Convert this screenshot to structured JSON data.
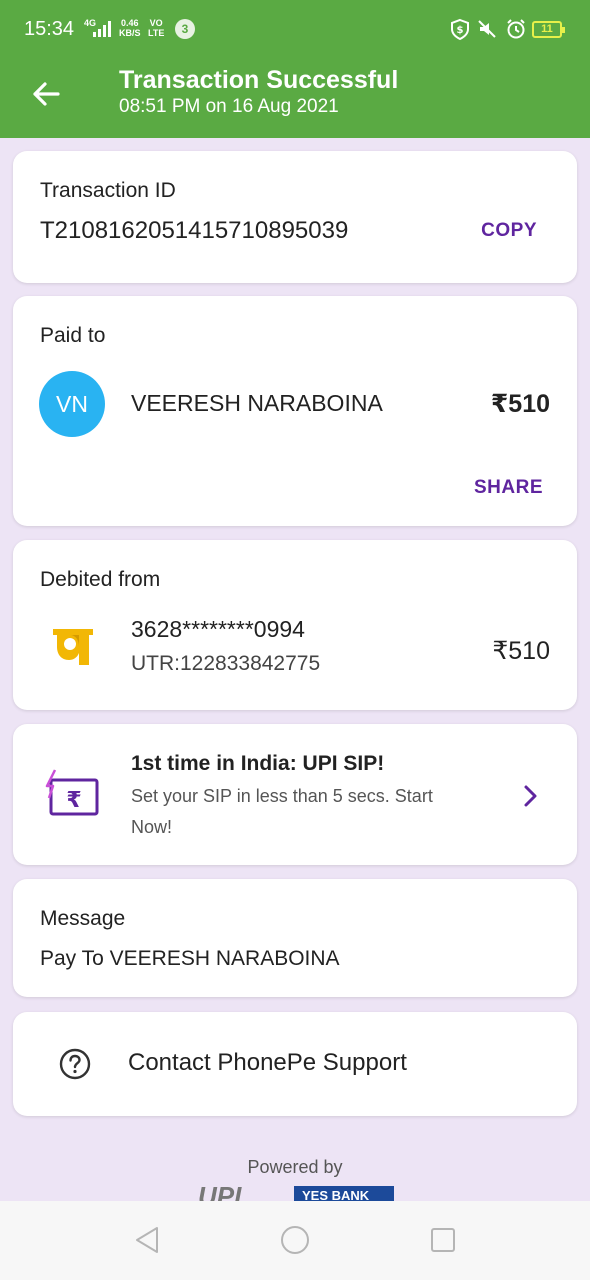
{
  "status_bar": {
    "time": "15:34",
    "network_top": "4G",
    "speed_value": "0.46",
    "speed_unit": "KB/S",
    "volte_top": "VO",
    "volte_bottom": "LTE",
    "notification_count": "3",
    "battery": "11"
  },
  "header": {
    "title": "Transaction Successful",
    "subtitle": "08:51 PM on 16 Aug 2021"
  },
  "transaction": {
    "label": "Transaction ID",
    "id": "T2108162051415710895039",
    "copy_label": "COPY"
  },
  "paid_to": {
    "label": "Paid to",
    "initials": "VN",
    "name": "VEERESH NARABOINA",
    "amount": "₹510",
    "share_label": "SHARE"
  },
  "debited_from": {
    "label": "Debited from",
    "account": "3628********0994",
    "utr": "UTR:122833842775",
    "amount": "₹510"
  },
  "promo": {
    "title": "1st time in India: UPI SIP!",
    "description_line1": "Set your SIP in less than 5 secs. Start",
    "description_line2": "Now!"
  },
  "message": {
    "label": "Message",
    "text": "Pay To VEERESH NARABOINA"
  },
  "support": {
    "label": "Contact PhonePe Support"
  },
  "footer": {
    "powered_by": "Powered by",
    "upi_logo": "UPI",
    "bank_logo": "YES BANK"
  },
  "colors": {
    "header_green": "#5aaa43",
    "background": "#ede4f5",
    "accent_purple": "#5f259f",
    "avatar_blue": "#29b3f2"
  },
  "icons": {
    "back": "arrow-left-icon",
    "bank": "pnb-bank-icon",
    "promo": "rupee-card-icon",
    "chevron": "chevron-right-icon",
    "support": "help-circle-icon"
  }
}
